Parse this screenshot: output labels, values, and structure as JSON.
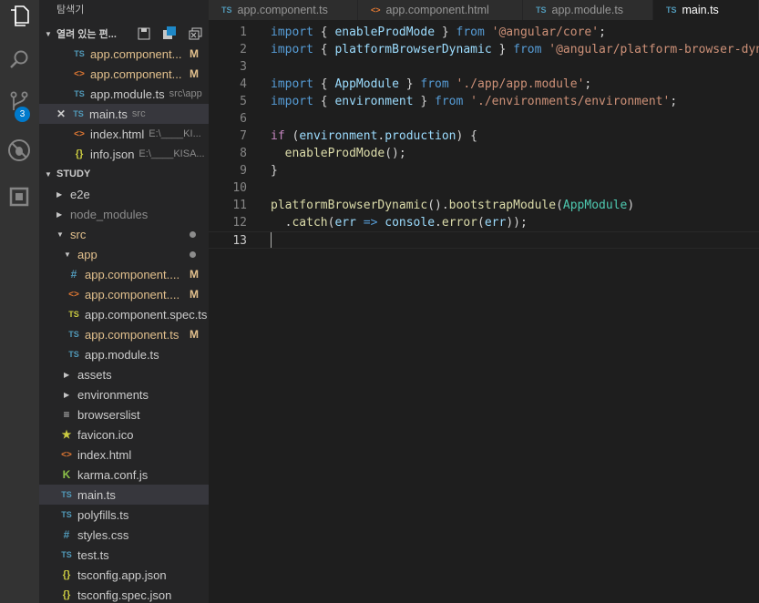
{
  "colors": {
    "accent": "#007acc",
    "modified": "#e2c08d",
    "activity_bar": "#333333",
    "sidebar": "#252526",
    "editor": "#1e1e1e"
  },
  "activity_bar": {
    "icons": [
      "files-icon",
      "search-icon",
      "source-control-icon",
      "debug-icon",
      "extensions-icon"
    ],
    "scm_badge": "3"
  },
  "sidebar": {
    "title": "탐색기",
    "open_editors": {
      "label": "열려 있는 편...",
      "items": [
        {
          "icon": "TS",
          "name": "app.component...",
          "mark": "M"
        },
        {
          "icon": "<>",
          "name": "app.component...",
          "mark": "M"
        },
        {
          "icon": "TS",
          "name": "app.module.ts",
          "path": "src\\app"
        },
        {
          "icon": "TS",
          "name": "main.ts",
          "path": "src"
        },
        {
          "icon": "<>",
          "name": "index.html",
          "path": "E:\\____KI..."
        },
        {
          "icon": "{}",
          "name": "info.json",
          "path": "E:\\____KISA..."
        }
      ]
    },
    "study": {
      "label": "STUDY",
      "tree": [
        {
          "name": "e2e"
        },
        {
          "name": "node_modules"
        },
        {
          "name": "src"
        },
        {
          "name": "app"
        },
        {
          "icon": "#",
          "name": "app.component....",
          "mark": "M"
        },
        {
          "icon": "<>",
          "name": "app.component....",
          "mark": "M"
        },
        {
          "icon": "TS",
          "name": "app.component.spec.ts"
        },
        {
          "icon": "TS",
          "name": "app.component.ts",
          "mark": "M"
        },
        {
          "icon": "TS",
          "name": "app.module.ts"
        },
        {
          "name": "assets"
        },
        {
          "name": "environments"
        },
        {
          "icon": "≡",
          "name": "browserslist"
        },
        {
          "icon": "★",
          "name": "favicon.ico"
        },
        {
          "icon": "<>",
          "name": "index.html"
        },
        {
          "icon": "K",
          "name": "karma.conf.js"
        },
        {
          "icon": "TS",
          "name": "main.ts"
        },
        {
          "icon": "TS",
          "name": "polyfills.ts"
        },
        {
          "icon": "#",
          "name": "styles.css"
        },
        {
          "icon": "TS",
          "name": "test.ts"
        },
        {
          "icon": "{}",
          "name": "tsconfig.app.json"
        },
        {
          "icon": "{}",
          "name": "tsconfig.spec.json"
        }
      ]
    }
  },
  "tabs": [
    {
      "icon": "TS",
      "label": "app.component.ts"
    },
    {
      "icon": "<>",
      "label": "app.component.html"
    },
    {
      "icon": "TS",
      "label": "app.module.ts"
    },
    {
      "icon": "TS",
      "label": "main.ts"
    }
  ],
  "editor": {
    "line_numbers": [
      "1",
      "2",
      "3",
      "4",
      "5",
      "6",
      "7",
      "8",
      "9",
      "10",
      "11",
      "12",
      "13"
    ],
    "lines": [
      [
        [
          "kw",
          "import"
        ],
        [
          "plain",
          " { "
        ],
        [
          "var",
          "enableProdMode"
        ],
        [
          "plain",
          " } "
        ],
        [
          "kw",
          "from"
        ],
        [
          "plain",
          " "
        ],
        [
          "str",
          "'@angular/core'"
        ],
        [
          "plain",
          ";"
        ]
      ],
      [
        [
          "kw",
          "import"
        ],
        [
          "plain",
          " { "
        ],
        [
          "var",
          "platformBrowserDynamic"
        ],
        [
          "plain",
          " } "
        ],
        [
          "kw",
          "from"
        ],
        [
          "plain",
          " "
        ],
        [
          "str",
          "'@angular/platform-browser-dyna"
        ]
      ],
      [],
      [
        [
          "kw",
          "import"
        ],
        [
          "plain",
          " { "
        ],
        [
          "var",
          "AppModule"
        ],
        [
          "plain",
          " } "
        ],
        [
          "kw",
          "from"
        ],
        [
          "plain",
          " "
        ],
        [
          "str",
          "'./app/app.module'"
        ],
        [
          "plain",
          ";"
        ]
      ],
      [
        [
          "kw",
          "import"
        ],
        [
          "plain",
          " { "
        ],
        [
          "var",
          "environment"
        ],
        [
          "plain",
          " } "
        ],
        [
          "kw",
          "from"
        ],
        [
          "plain",
          " "
        ],
        [
          "str",
          "'./environments/environment'"
        ],
        [
          "plain",
          ";"
        ]
      ],
      [],
      [
        [
          "ctrl",
          "if"
        ],
        [
          "plain",
          " ("
        ],
        [
          "var",
          "environment"
        ],
        [
          "plain",
          "."
        ],
        [
          "var",
          "production"
        ],
        [
          "plain",
          ") {"
        ]
      ],
      [
        [
          "plain",
          "  "
        ],
        [
          "fn",
          "enableProdMode"
        ],
        [
          "plain",
          "();"
        ]
      ],
      [
        [
          "plain",
          "}"
        ]
      ],
      [],
      [
        [
          "fn",
          "platformBrowserDynamic"
        ],
        [
          "plain",
          "()."
        ],
        [
          "fn",
          "bootstrapModule"
        ],
        [
          "plain",
          "("
        ],
        [
          "cls",
          "AppModule"
        ],
        [
          "plain",
          ")"
        ]
      ],
      [
        [
          "plain",
          "  ."
        ],
        [
          "fn",
          "catch"
        ],
        [
          "plain",
          "("
        ],
        [
          "var",
          "err"
        ],
        [
          "plain",
          " "
        ],
        [
          "kw",
          "=>"
        ],
        [
          "plain",
          " "
        ],
        [
          "var",
          "console"
        ],
        [
          "plain",
          "."
        ],
        [
          "fn",
          "error"
        ],
        [
          "plain",
          "("
        ],
        [
          "var",
          "err"
        ],
        [
          "plain",
          "));"
        ]
      ],
      []
    ]
  }
}
